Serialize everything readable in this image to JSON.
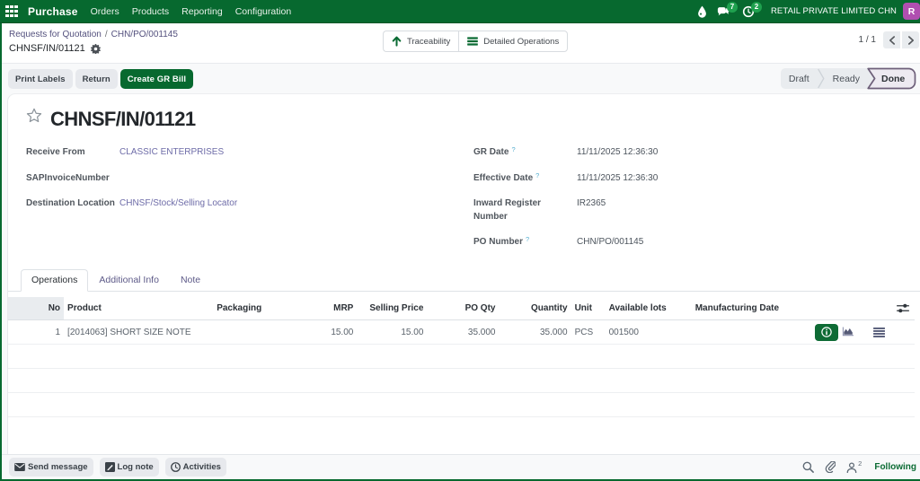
{
  "topbar": {
    "brand": "Purchase",
    "menus": [
      "Orders",
      "Products",
      "Reporting",
      "Configuration"
    ],
    "message_badge": "7",
    "activity_badge": "2",
    "company": "RETAIL PRIVATE LIMITED CHN",
    "avatar_initial": "R"
  },
  "breadcrumb": {
    "level1": "Requests for Quotation",
    "separator": "/",
    "level2": "CHN/PO/001145",
    "current": "CHNSF/IN/01121"
  },
  "control_buttons": {
    "traceability": "Traceability",
    "detailed_operations": "Detailed Operations"
  },
  "pager": {
    "text": "1 / 1"
  },
  "actions": {
    "print_labels": "Print Labels",
    "return": "Return",
    "create_gr_bill": "Create GR Bill"
  },
  "statusbar": {
    "steps": [
      "Draft",
      "Ready",
      "Done"
    ],
    "active": "Done"
  },
  "form": {
    "title": "CHNSF/IN/01121",
    "fields_left": [
      {
        "label": "Receive From",
        "value": "CLASSIC ENTERPRISES"
      },
      {
        "label": "SAPInvoiceNumber",
        "value": ""
      },
      {
        "label": "Destination Location",
        "value": "CHNSF/Stock/Selling Locator"
      }
    ],
    "fields_right": [
      {
        "label": "GR Date",
        "help": "?",
        "value": "11/11/2025 12:36:30"
      },
      {
        "label": "Effective Date",
        "help": "?",
        "value": "11/11/2025 12:36:30"
      },
      {
        "label": "Inward Register Number",
        "help": "",
        "value": "IR2365"
      },
      {
        "label": "PO Number",
        "help": "?",
        "value": "CHN/PO/001145"
      }
    ],
    "tabs": [
      "Operations",
      "Additional Info",
      "Note"
    ],
    "table": {
      "columns": [
        "No",
        "Product",
        "Packaging",
        "MRP",
        "Selling Price",
        "PO Qty",
        "Quantity",
        "Unit",
        "Available lots",
        "Manufacturing Date"
      ],
      "rows": [
        {
          "no": "1",
          "product": "[2014063] SHORT SIZE NOTE",
          "packaging": "",
          "mrp": "15.00",
          "selling_price": "15.00",
          "po_qty": "35.000",
          "quantity": "35.000",
          "unit": "PCS",
          "available_lots": "001500",
          "manufacturing_date": ""
        }
      ]
    }
  },
  "chatter": {
    "send_message": "Send message",
    "log_note": "Log note",
    "activities": "Activities",
    "follower_count": "2",
    "following": "Following"
  }
}
